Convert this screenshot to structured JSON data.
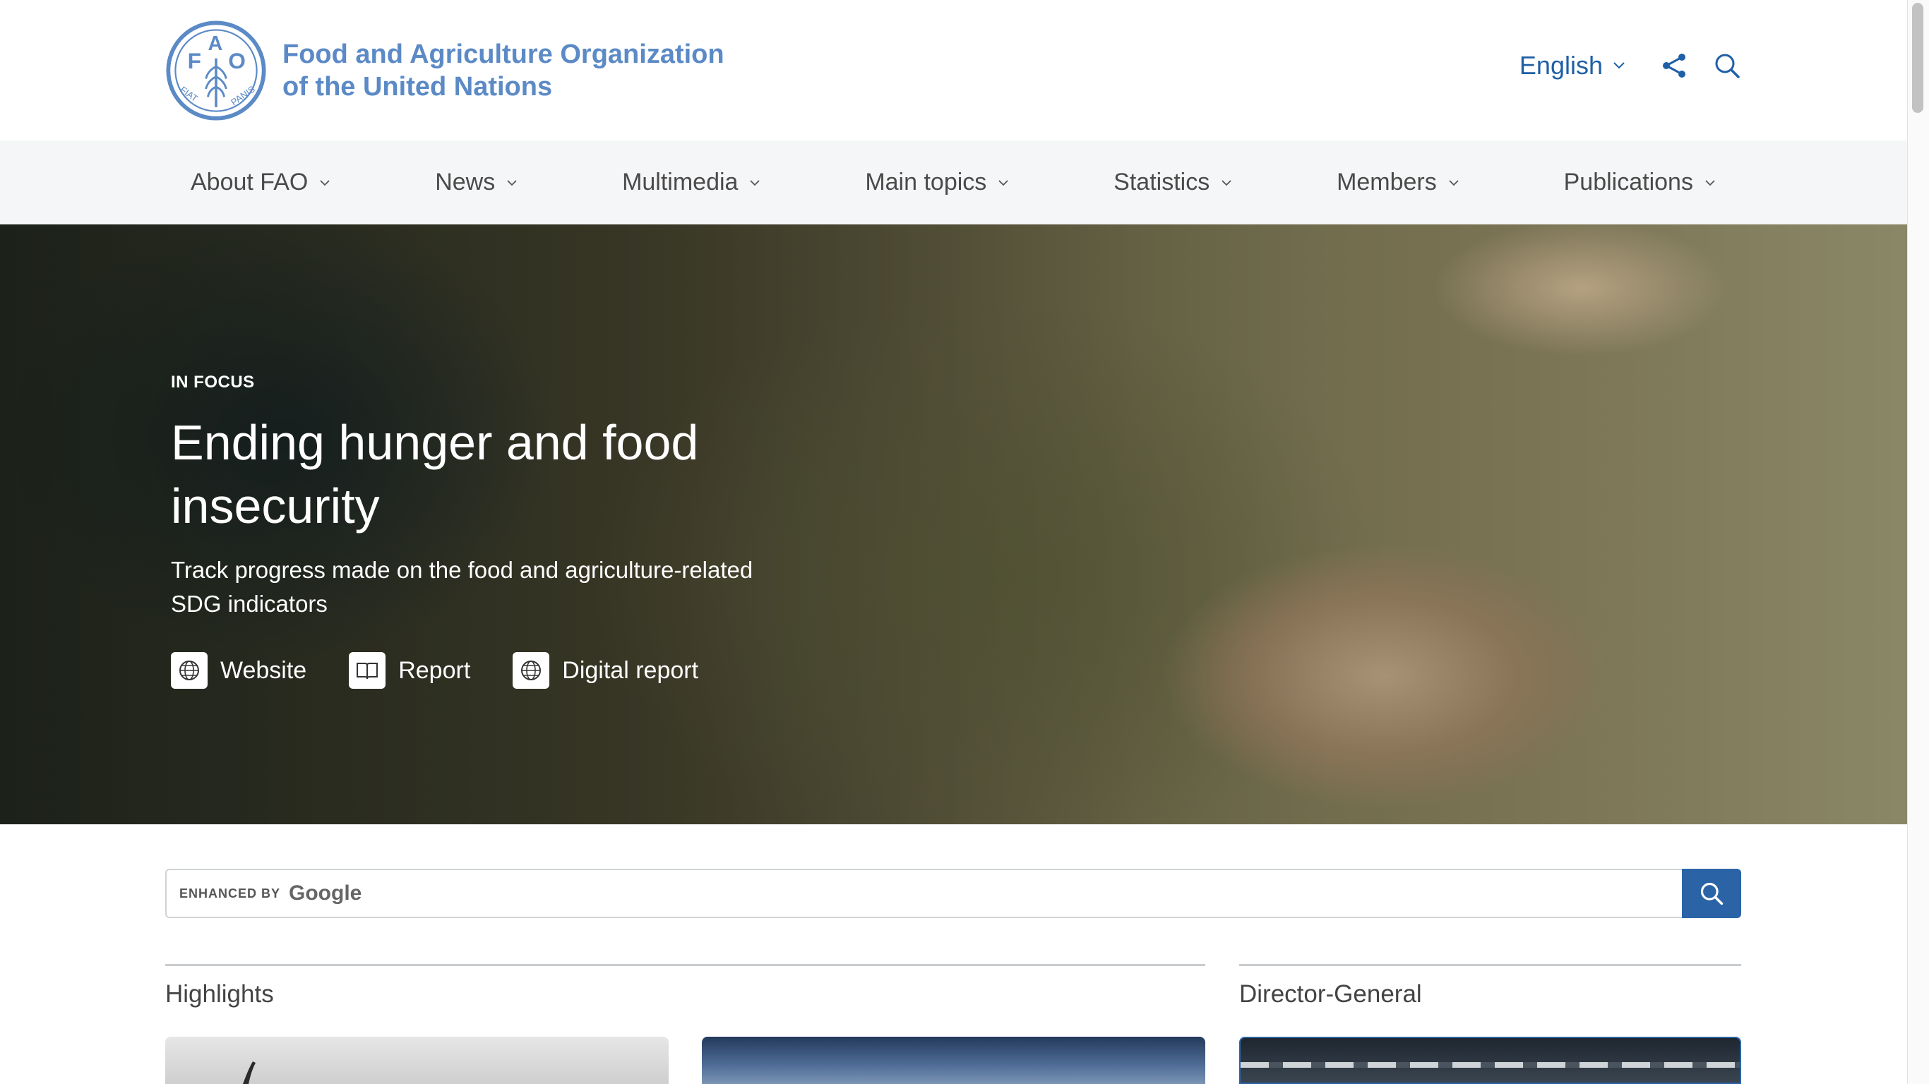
{
  "header": {
    "org_name_line1": "Food and Agriculture Organization",
    "org_name_line2": "of the United Nations",
    "logo_letters": [
      "F",
      "A",
      "O"
    ],
    "logo_motto": "FIAT PANIS",
    "language": "English",
    "icons": [
      "chevron-down-icon",
      "share-icon",
      "search-icon"
    ]
  },
  "nav": {
    "items": [
      {
        "label": "About FAO"
      },
      {
        "label": "News"
      },
      {
        "label": "Multimedia"
      },
      {
        "label": "Main topics"
      },
      {
        "label": "Statistics"
      },
      {
        "label": "Members"
      },
      {
        "label": "Publications"
      }
    ]
  },
  "hero": {
    "kicker": "IN FOCUS",
    "title": "Ending hunger and food insecurity",
    "subtitle": "Track progress made on the food and agriculture-related SDG indicators",
    "links": [
      {
        "label": "Website",
        "icon": "globe-icon"
      },
      {
        "label": "Report",
        "icon": "book-icon"
      },
      {
        "label": "Digital report",
        "icon": "globe-icon"
      }
    ]
  },
  "search": {
    "enhanced_label": "ENHANCED BY",
    "brand": "Google",
    "value": ""
  },
  "sections": {
    "highlights_title": "Highlights",
    "dg_title": "Director-General"
  },
  "colors": {
    "brand_blue": "#5b8ac6",
    "link_blue": "#1f5fa6",
    "search_button": "#2b64a6",
    "nav_bg": "#f5f6f7"
  }
}
